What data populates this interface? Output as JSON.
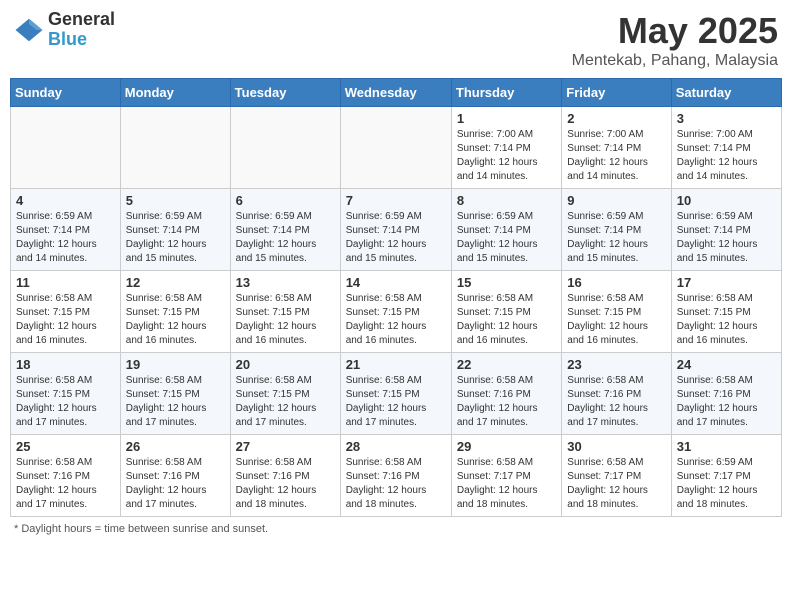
{
  "logo": {
    "general": "General",
    "blue": "Blue"
  },
  "title": {
    "month": "May 2025",
    "location": "Mentekab, Pahang, Malaysia"
  },
  "days_header": [
    "Sunday",
    "Monday",
    "Tuesday",
    "Wednesday",
    "Thursday",
    "Friday",
    "Saturday"
  ],
  "footer": {
    "note": "Daylight hours"
  },
  "weeks": [
    [
      {
        "day": "",
        "info": ""
      },
      {
        "day": "",
        "info": ""
      },
      {
        "day": "",
        "info": ""
      },
      {
        "day": "",
        "info": ""
      },
      {
        "day": "1",
        "info": "Sunrise: 7:00 AM\nSunset: 7:14 PM\nDaylight: 12 hours\nand 14 minutes."
      },
      {
        "day": "2",
        "info": "Sunrise: 7:00 AM\nSunset: 7:14 PM\nDaylight: 12 hours\nand 14 minutes."
      },
      {
        "day": "3",
        "info": "Sunrise: 7:00 AM\nSunset: 7:14 PM\nDaylight: 12 hours\nand 14 minutes."
      }
    ],
    [
      {
        "day": "4",
        "info": "Sunrise: 6:59 AM\nSunset: 7:14 PM\nDaylight: 12 hours\nand 14 minutes."
      },
      {
        "day": "5",
        "info": "Sunrise: 6:59 AM\nSunset: 7:14 PM\nDaylight: 12 hours\nand 15 minutes."
      },
      {
        "day": "6",
        "info": "Sunrise: 6:59 AM\nSunset: 7:14 PM\nDaylight: 12 hours\nand 15 minutes."
      },
      {
        "day": "7",
        "info": "Sunrise: 6:59 AM\nSunset: 7:14 PM\nDaylight: 12 hours\nand 15 minutes."
      },
      {
        "day": "8",
        "info": "Sunrise: 6:59 AM\nSunset: 7:14 PM\nDaylight: 12 hours\nand 15 minutes."
      },
      {
        "day": "9",
        "info": "Sunrise: 6:59 AM\nSunset: 7:14 PM\nDaylight: 12 hours\nand 15 minutes."
      },
      {
        "day": "10",
        "info": "Sunrise: 6:59 AM\nSunset: 7:14 PM\nDaylight: 12 hours\nand 15 minutes."
      }
    ],
    [
      {
        "day": "11",
        "info": "Sunrise: 6:58 AM\nSunset: 7:15 PM\nDaylight: 12 hours\nand 16 minutes."
      },
      {
        "day": "12",
        "info": "Sunrise: 6:58 AM\nSunset: 7:15 PM\nDaylight: 12 hours\nand 16 minutes."
      },
      {
        "day": "13",
        "info": "Sunrise: 6:58 AM\nSunset: 7:15 PM\nDaylight: 12 hours\nand 16 minutes."
      },
      {
        "day": "14",
        "info": "Sunrise: 6:58 AM\nSunset: 7:15 PM\nDaylight: 12 hours\nand 16 minutes."
      },
      {
        "day": "15",
        "info": "Sunrise: 6:58 AM\nSunset: 7:15 PM\nDaylight: 12 hours\nand 16 minutes."
      },
      {
        "day": "16",
        "info": "Sunrise: 6:58 AM\nSunset: 7:15 PM\nDaylight: 12 hours\nand 16 minutes."
      },
      {
        "day": "17",
        "info": "Sunrise: 6:58 AM\nSunset: 7:15 PM\nDaylight: 12 hours\nand 16 minutes."
      }
    ],
    [
      {
        "day": "18",
        "info": "Sunrise: 6:58 AM\nSunset: 7:15 PM\nDaylight: 12 hours\nand 17 minutes."
      },
      {
        "day": "19",
        "info": "Sunrise: 6:58 AM\nSunset: 7:15 PM\nDaylight: 12 hours\nand 17 minutes."
      },
      {
        "day": "20",
        "info": "Sunrise: 6:58 AM\nSunset: 7:15 PM\nDaylight: 12 hours\nand 17 minutes."
      },
      {
        "day": "21",
        "info": "Sunrise: 6:58 AM\nSunset: 7:15 PM\nDaylight: 12 hours\nand 17 minutes."
      },
      {
        "day": "22",
        "info": "Sunrise: 6:58 AM\nSunset: 7:16 PM\nDaylight: 12 hours\nand 17 minutes."
      },
      {
        "day": "23",
        "info": "Sunrise: 6:58 AM\nSunset: 7:16 PM\nDaylight: 12 hours\nand 17 minutes."
      },
      {
        "day": "24",
        "info": "Sunrise: 6:58 AM\nSunset: 7:16 PM\nDaylight: 12 hours\nand 17 minutes."
      }
    ],
    [
      {
        "day": "25",
        "info": "Sunrise: 6:58 AM\nSunset: 7:16 PM\nDaylight: 12 hours\nand 17 minutes."
      },
      {
        "day": "26",
        "info": "Sunrise: 6:58 AM\nSunset: 7:16 PM\nDaylight: 12 hours\nand 17 minutes."
      },
      {
        "day": "27",
        "info": "Sunrise: 6:58 AM\nSunset: 7:16 PM\nDaylight: 12 hours\nand 18 minutes."
      },
      {
        "day": "28",
        "info": "Sunrise: 6:58 AM\nSunset: 7:16 PM\nDaylight: 12 hours\nand 18 minutes."
      },
      {
        "day": "29",
        "info": "Sunrise: 6:58 AM\nSunset: 7:17 PM\nDaylight: 12 hours\nand 18 minutes."
      },
      {
        "day": "30",
        "info": "Sunrise: 6:58 AM\nSunset: 7:17 PM\nDaylight: 12 hours\nand 18 minutes."
      },
      {
        "day": "31",
        "info": "Sunrise: 6:59 AM\nSunset: 7:17 PM\nDaylight: 12 hours\nand 18 minutes."
      }
    ]
  ]
}
